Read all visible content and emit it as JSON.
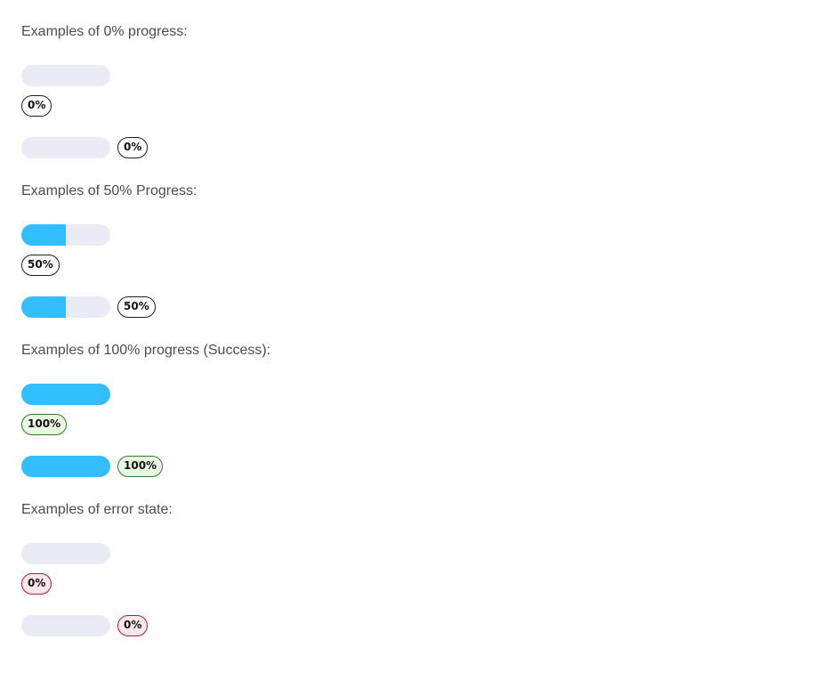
{
  "sections": [
    {
      "heading": "Examples of 0% progress:",
      "progress": 0,
      "variant": "default",
      "badge_label": "0%"
    },
    {
      "heading": "Examples of 50% Progress:",
      "progress": 50,
      "variant": "default",
      "badge_label": "50%"
    },
    {
      "heading": "Examples of 100% progress (Success):",
      "progress": 100,
      "variant": "success",
      "badge_label": "100%"
    },
    {
      "heading": "Examples of error state:",
      "progress": 0,
      "variant": "error",
      "badge_label": "0%"
    }
  ],
  "colors": {
    "fill": "#33bfff",
    "track": "#ebebf5",
    "success_bg": "#e8f8e2",
    "error_bg": "#fde7ec"
  }
}
